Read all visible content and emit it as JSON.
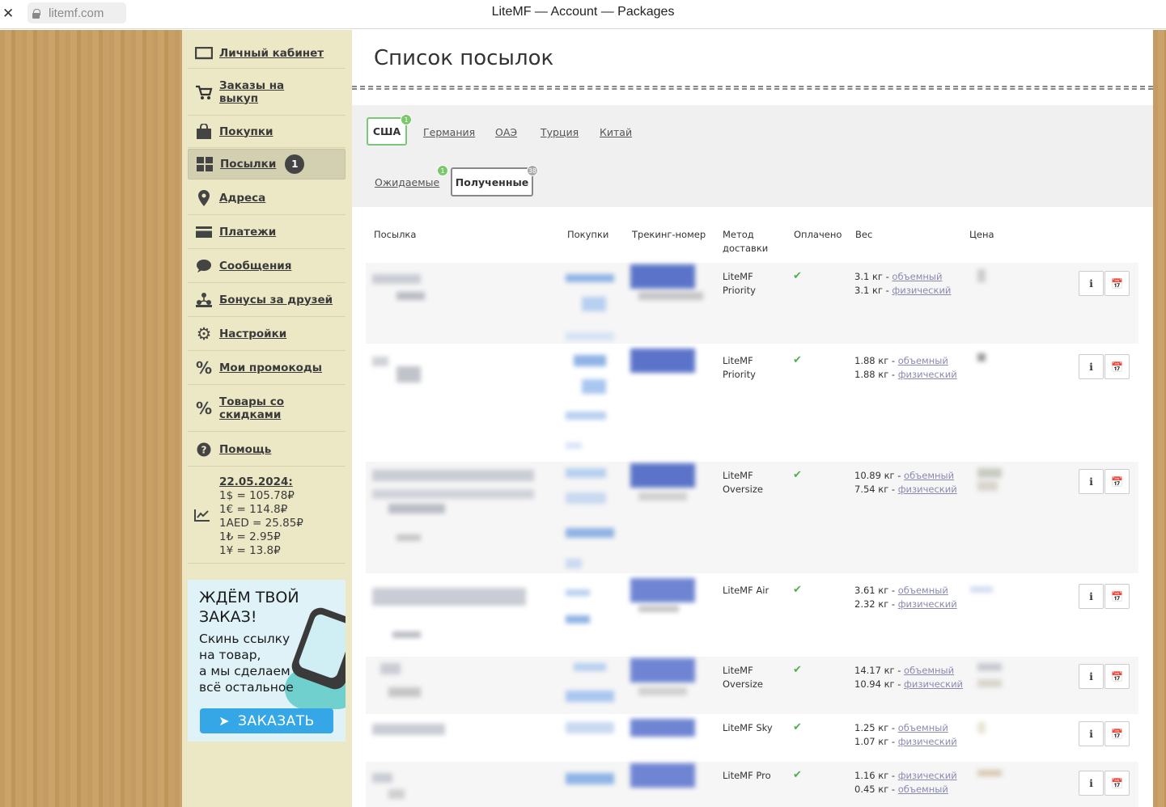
{
  "browser": {
    "url": "litemf.com",
    "title": "LiteMF — Account — Packages",
    "close_icon": "close-icon",
    "lock_icon": "lock-icon"
  },
  "sidebar": {
    "items": [
      {
        "label": "Личный кабинет",
        "icon": "monitor-icon"
      },
      {
        "label": "Заказы на выкуп",
        "icon": "cart-icon"
      },
      {
        "label": "Покупки",
        "icon": "bag-icon"
      },
      {
        "label": "Посылки",
        "icon": "grid-icon",
        "badge": "1",
        "active": true
      },
      {
        "label": "Адреса",
        "icon": "map-pin-icon"
      },
      {
        "label": "Платежи",
        "icon": "credit-card-icon"
      },
      {
        "label": "Сообщения",
        "icon": "chat-icon"
      },
      {
        "label": "Бонусы за друзей",
        "icon": "people-icon"
      },
      {
        "label": "Настройки",
        "icon": "gear-icon"
      },
      {
        "label": "Мои промокоды",
        "icon": "percent-icon"
      },
      {
        "label": "Товары со скидками",
        "icon": "percent-icon"
      },
      {
        "label": "Помощь",
        "icon": "help-icon"
      }
    ],
    "rates": {
      "icon": "chart-icon",
      "date": "22.05.2024:",
      "lines": [
        "1$ = 105.78₽",
        "1€ = 114.8₽",
        "1AED = 25.85₽",
        "1₺ = 2.95₽",
        "1¥ = 13.8₽"
      ]
    },
    "promo": {
      "headline_1": "ЖДЁМ ТВОЙ",
      "headline_2": "ЗАКАЗ!",
      "text": "Скинь ссылку\nна товар,\nа мы сделаем\nвсё остальное",
      "button": "ЗАКАЗАТЬ",
      "button_icon": "paper-plane-icon"
    }
  },
  "main": {
    "title": "Список посылок",
    "country_tabs": [
      {
        "label": "США",
        "selected": true,
        "badge": "1"
      },
      {
        "label": "Германия"
      },
      {
        "label": "ОАЭ"
      },
      {
        "label": "Турция"
      },
      {
        "label": "Китай"
      }
    ],
    "status_tabs": [
      {
        "label": "Ожидаемые",
        "badge": "1"
      },
      {
        "label": "Полученные",
        "selected": true,
        "badge": "38"
      }
    ],
    "columns": {
      "package": "Посылка",
      "purchases": "Покупки",
      "tracking": "Трекинг-номер",
      "method_1": "Метод",
      "method_2": "доставки",
      "paid": "Оплачено",
      "weight": "Вес",
      "price": "Цена"
    },
    "rows": [
      {
        "method": "LiteMF Priority",
        "paid": true,
        "w1": "3.1 кг - ",
        "l1": "объемный",
        "w2": "3.1 кг - ",
        "l2": "физический"
      },
      {
        "method": "LiteMF Priority",
        "paid": true,
        "w1": "1.88 кг - ",
        "l1": "объемный",
        "w2": "1.88 кг - ",
        "l2": "физический"
      },
      {
        "method": "LiteMF Oversize",
        "paid": true,
        "w1": "10.89 кг - ",
        "l1": "объемный",
        "w2": "7.54 кг - ",
        "l2": "физический"
      },
      {
        "method": "LiteMF Air",
        "paid": true,
        "w1": "3.61 кг - ",
        "l1": "объемный",
        "w2": "2.32 кг - ",
        "l2": "физический"
      },
      {
        "method": "LiteMF Oversize",
        "paid": true,
        "w1": "14.17 кг - ",
        "l1": "объемный",
        "w2": "10.94 кг - ",
        "l2": "физический"
      },
      {
        "method": "LiteMF Sky",
        "paid": true,
        "w1": "1.25 кг - ",
        "l1": "объемный",
        "w2": "1.07 кг - ",
        "l2": "физический"
      },
      {
        "method": "LiteMF Pro",
        "paid": true,
        "w1": "1.16 кг - ",
        "l1": "физический",
        "w2": "0.45 кг - ",
        "l2": "объемный"
      }
    ],
    "info_button": "i",
    "info_icon": "info-icon",
    "calendar_icon": "calendar-icon",
    "check_icon": "check-icon"
  }
}
